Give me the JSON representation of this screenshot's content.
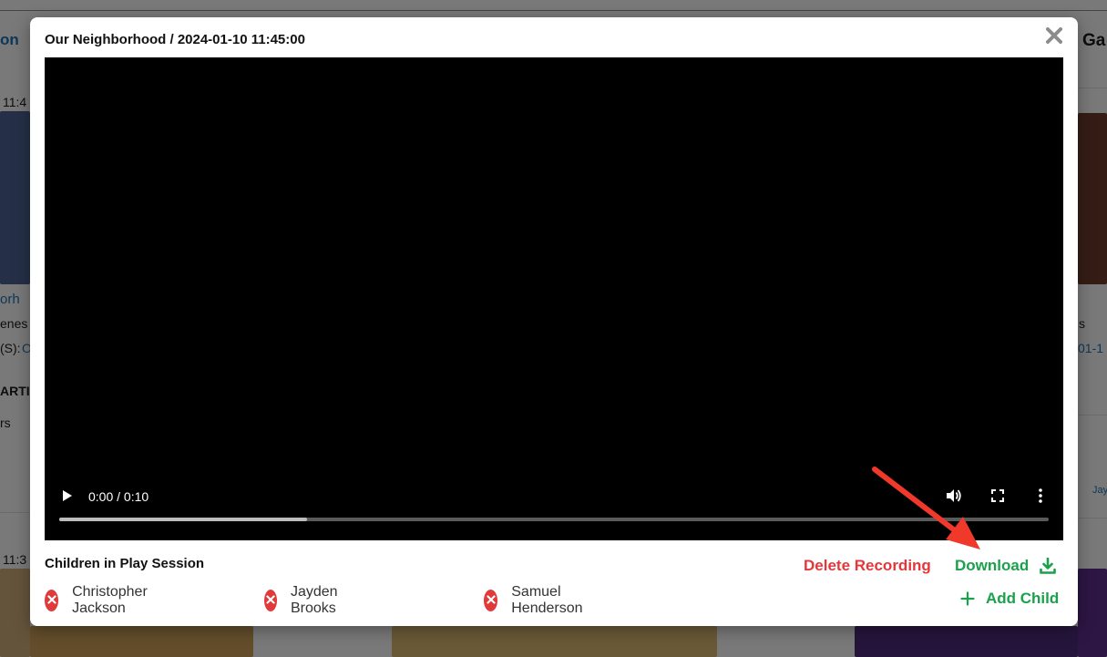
{
  "background": {
    "left_texts": [
      "on",
      "11:4",
      "orh",
      "enes",
      "(S):",
      "O",
      "ARTI",
      "rs",
      "11:3"
    ],
    "right_texts": [
      "Ga",
      "s",
      "01-1",
      "Jay"
    ]
  },
  "modal": {
    "title": "Our Neighborhood / 2024-01-10 11:45:00",
    "close_icon": "close-icon"
  },
  "video": {
    "time_display": "0:00 / 0:10",
    "progress_fraction": 0.25,
    "controls": [
      "play-icon",
      "volume-icon",
      "fullscreen-icon",
      "more-options-icon"
    ]
  },
  "children_section": {
    "title": "Children in Play Session",
    "children": [
      {
        "name": "Christopher Jackson"
      },
      {
        "name": "Jayden Brooks"
      },
      {
        "name": "Samuel Henderson"
      }
    ]
  },
  "actions": {
    "delete_label": "Delete Recording",
    "download_label": "Download",
    "add_child_label": "Add Child"
  },
  "colors": {
    "delete": "#e5373b",
    "accent_green": "#1aa14b",
    "remove_red": "#e03a3a",
    "annotation_arrow": "#f0382b"
  }
}
